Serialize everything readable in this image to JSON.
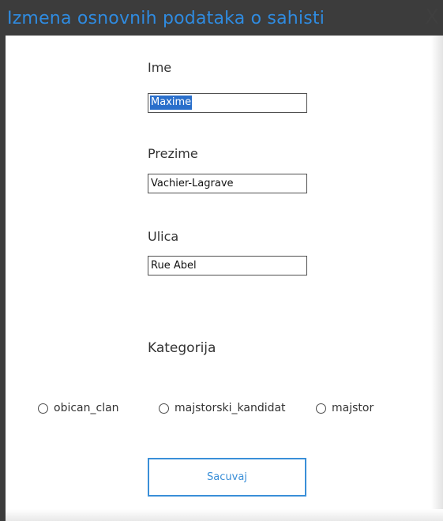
{
  "window": {
    "title": "Izmena osnovnih podataka o sahisti",
    "close_glyph": "X",
    "accent_color": "#2f8be0",
    "titlebar_color": "#3c3c3c"
  },
  "form": {
    "ime": {
      "label": "Ime",
      "value": "Maxime"
    },
    "prezime": {
      "label": "Prezime",
      "value": "Vachier-Lagrave"
    },
    "ulica": {
      "label": "Ulica",
      "value": "Rue Abel"
    },
    "kategorija": {
      "label": "Kategorija",
      "options": [
        "obican_clan",
        "majstorski_kandidat",
        "majstor"
      ],
      "selected": null
    }
  },
  "actions": {
    "save_label": "Sacuvaj"
  }
}
